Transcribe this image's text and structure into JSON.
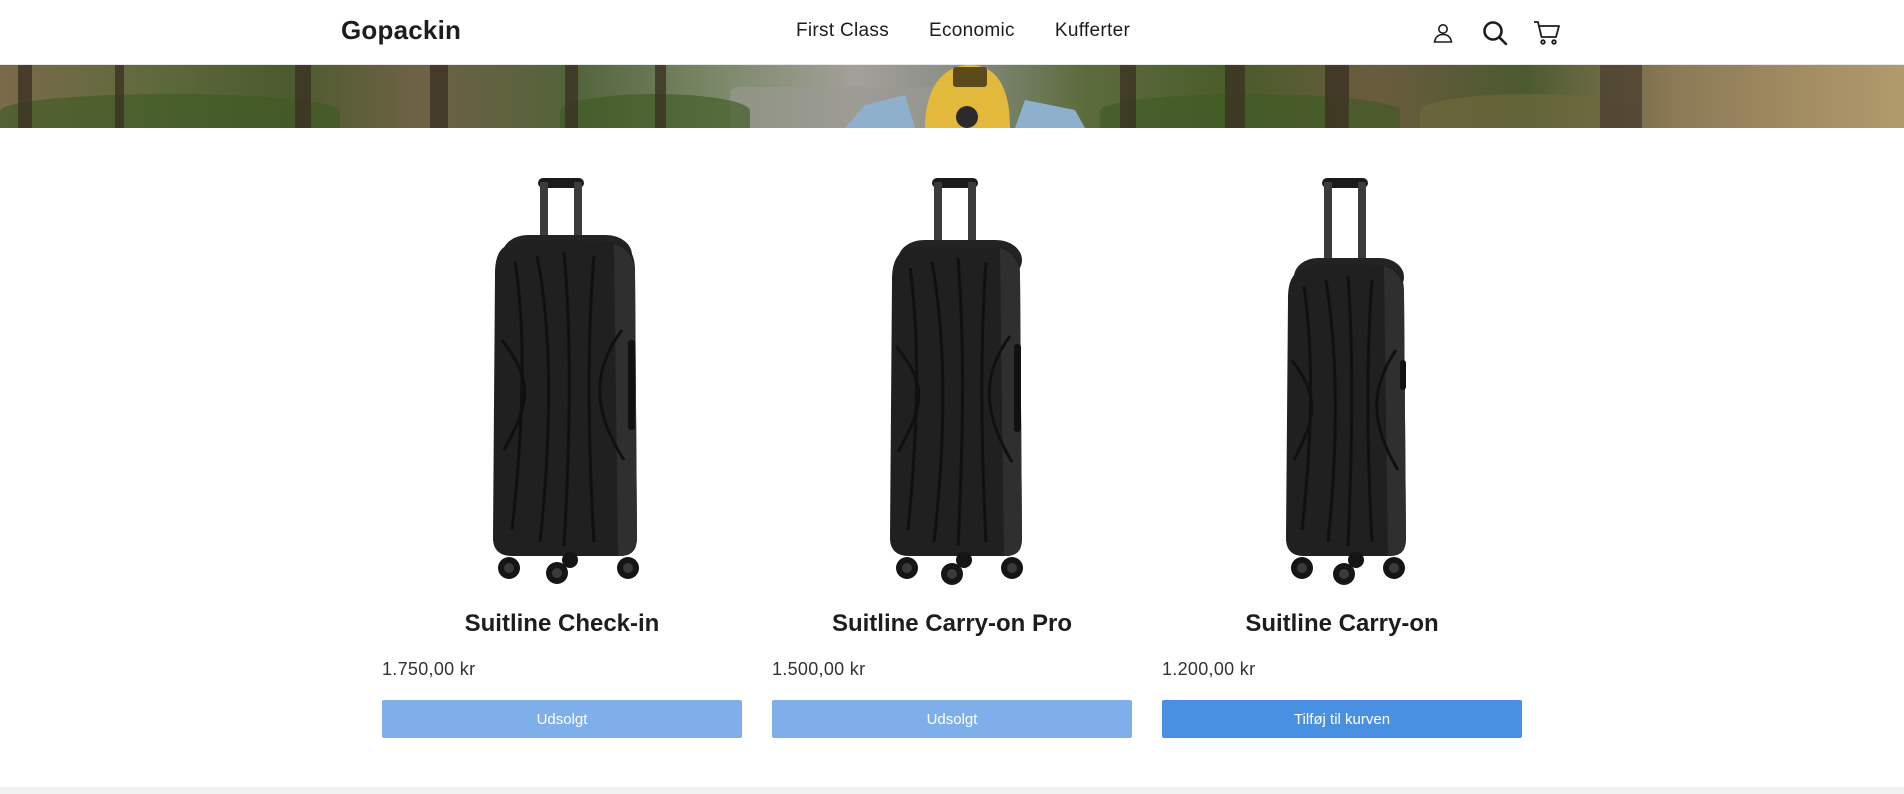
{
  "header": {
    "logo": "Gopackin",
    "nav": [
      "First Class",
      "Economic",
      "Kufferter"
    ],
    "icons": [
      "account-icon",
      "search-icon",
      "cart-icon"
    ]
  },
  "products": [
    {
      "title": "Suitline Check-in",
      "price": "1.750,00 kr",
      "button_label": "Udsolgt",
      "sold_out": true
    },
    {
      "title": "Suitline Carry-on Pro",
      "price": "1.500,00 kr",
      "button_label": "Udsolgt",
      "sold_out": true
    },
    {
      "title": "Suitline Carry-on",
      "price": "1.200,00 kr",
      "button_label": "Tilføj til kurven",
      "sold_out": false
    }
  ],
  "colors": {
    "button_primary": "#4a90e2",
    "button_disabled": "#7fafea",
    "text": "#1c1d1d"
  }
}
